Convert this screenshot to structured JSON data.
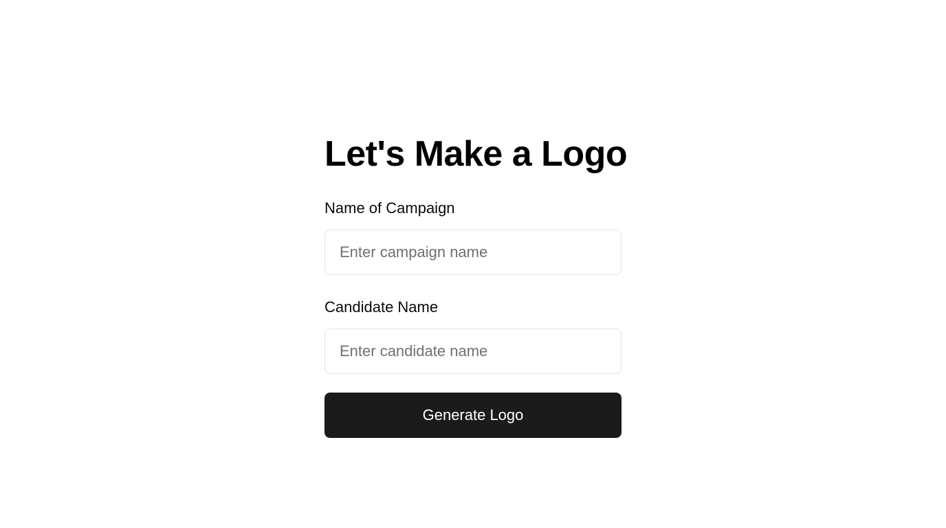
{
  "form": {
    "title": "Let's Make a Logo",
    "campaign": {
      "label": "Name of Campaign",
      "placeholder": "Enter campaign name",
      "value": ""
    },
    "candidate": {
      "label": "Candidate Name",
      "placeholder": "Enter candidate name",
      "value": ""
    },
    "submit_label": "Generate Logo"
  },
  "colors": {
    "background": "#ffffff",
    "text": "#000000",
    "input_border": "#e2e2e5",
    "placeholder": "#6f6f78",
    "button_background": "#1b1b1d",
    "button_text": "#ffffff"
  }
}
